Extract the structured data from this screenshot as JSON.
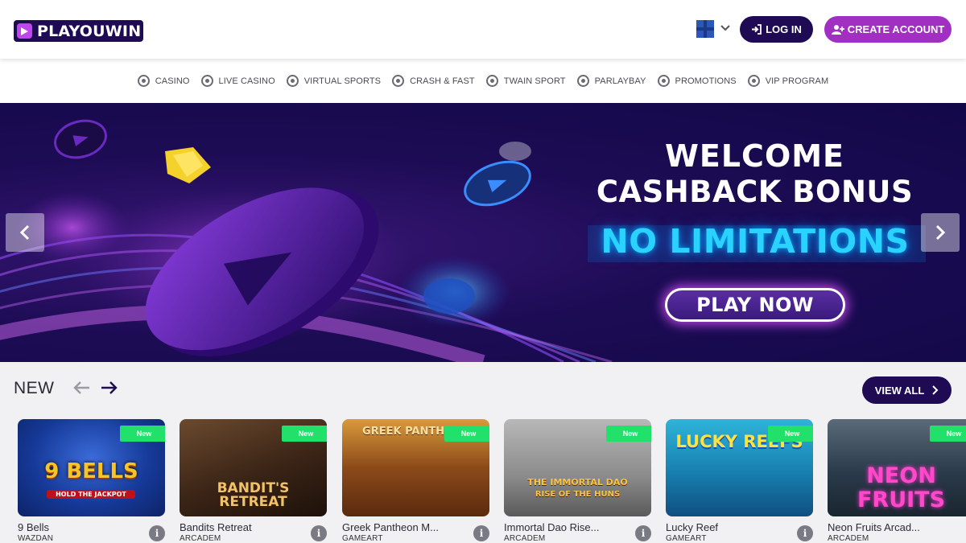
{
  "header": {
    "logo_text": "PLAYOUWIN",
    "login_label": "LOG IN",
    "create_account_label": "CREATE ACCOUNT",
    "language_flag": "flag-icon"
  },
  "nav": {
    "items": [
      {
        "label": "CASINO",
        "icon": "casino-chip-icon"
      },
      {
        "label": "LIVE CASINO",
        "icon": "live-casino-icon"
      },
      {
        "label": "VIRTUAL SPORTS",
        "icon": "virtual-sports-icon"
      },
      {
        "label": "CRASH & FAST",
        "icon": "rocket-icon"
      },
      {
        "label": "TWAIN SPORT",
        "icon": "ball-icon"
      },
      {
        "label": "PARLAYBAY",
        "icon": "parlaybay-icon"
      },
      {
        "label": "PROMOTIONS",
        "icon": "gift-icon"
      },
      {
        "label": "VIP PROGRAM",
        "icon": "crown-icon"
      }
    ]
  },
  "banner": {
    "line1": "WELCOME",
    "line2": "CASHBACK BONUS",
    "line3": "NO LIMITATIONS",
    "cta_label": "PLAY NOW"
  },
  "new_section": {
    "title": "NEW",
    "view_all_label": "VIEW ALL",
    "games": [
      {
        "name": "9 Bells",
        "provider": "WAZDAN",
        "badge": "New",
        "thumb_title": "9 BELLS",
        "thumb_sub": "HOLD THE JACKPOT"
      },
      {
        "name": "Bandits Retreat",
        "provider": "ARCADEM",
        "badge": "New",
        "thumb_title": "BANDIT'S RETREAT",
        "thumb_sub": ""
      },
      {
        "name": "Greek Pantheon M...",
        "provider": "GAMEART",
        "badge": "New",
        "thumb_title": "GREEK PANTHEON",
        "thumb_sub": ""
      },
      {
        "name": "Immortal Dao Rise...",
        "provider": "ARCADEM",
        "badge": "New",
        "thumb_title": "THE IMMORTAL DAO",
        "thumb_sub": "RISE OF THE HUNS"
      },
      {
        "name": "Lucky Reef",
        "provider": "GAMEART",
        "badge": "New",
        "thumb_title": "LUCKY REEFS",
        "thumb_sub": ""
      },
      {
        "name": "Neon Fruits Arcad...",
        "provider": "ARCADEM",
        "badge": "New",
        "thumb_title": "NEON FRUITS",
        "thumb_sub": ""
      }
    ]
  },
  "colors": {
    "brand_dark": "#1e0b53",
    "brand_purple": "#a02fc2",
    "badge_green": "#21e16b",
    "neon_cyan": "#2ad2ff"
  }
}
